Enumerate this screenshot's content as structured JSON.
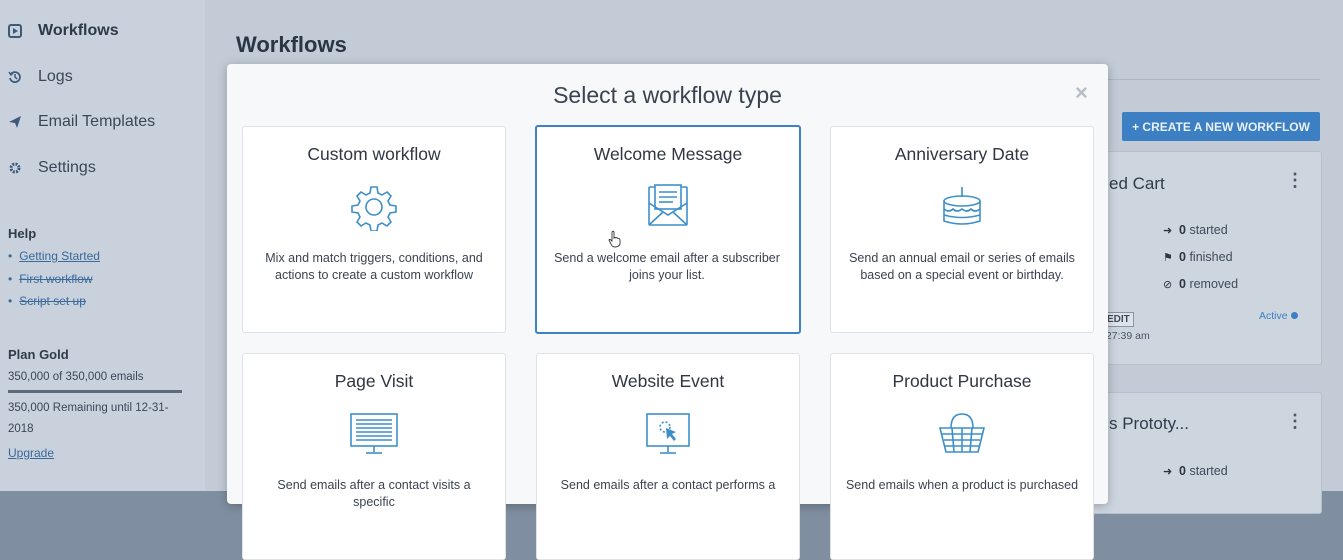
{
  "sidebar": {
    "nav": [
      {
        "label": "Workflows",
        "icon": "play-square-icon",
        "active": true
      },
      {
        "label": "Logs",
        "icon": "history-icon"
      },
      {
        "label": "Email Templates",
        "icon": "paper-plane-icon"
      },
      {
        "label": "Settings",
        "icon": "gear-icon"
      }
    ],
    "help_title": "Help",
    "help_links": [
      "Getting Started",
      "First workflow",
      "Script set up"
    ],
    "plan_title": "Plan Gold",
    "plan_usage": "350,000 of 350,000 emails",
    "plan_remaining_1": "350,000 Remaining until 12-31-",
    "plan_remaining_2": "2018",
    "upgrade": "Upgrade"
  },
  "main": {
    "title": "Workflows",
    "create_button": "+ CREATE A NEW WORKFLOW",
    "cards": [
      {
        "title": "ed Cart",
        "started": "0",
        "started_label": "started",
        "finished": "0",
        "finished_label": "finished",
        "removed": "0",
        "removed_label": "removed",
        "edit": "EDIT",
        "time": ":27:39 am",
        "status": "Active"
      },
      {
        "title": "s Prototy...",
        "started": "0",
        "started_label": "started"
      }
    ]
  },
  "modal": {
    "title": "Select a workflow type",
    "close": "×",
    "options": [
      {
        "title": "Custom workflow",
        "icon": "gear-icon",
        "desc": "Mix and match triggers, conditions, and actions to create a custom workflow"
      },
      {
        "title": "Welcome Message",
        "icon": "envelope-icon",
        "desc": "Send a welcome email after a subscriber joins your list.",
        "selected": true
      },
      {
        "title": "Anniversary Date",
        "icon": "birthday-cake-icon",
        "desc": "Send an annual email or series of emails based on a special event or birthday."
      },
      {
        "title": "Page Visit",
        "icon": "monitor-icon",
        "desc": "Send emails after a contact visits a specific"
      },
      {
        "title": "Website Event",
        "icon": "monitor-click-icon",
        "desc": "Send emails after a contact performs a"
      },
      {
        "title": "Product Purchase",
        "icon": "shopping-basket-icon",
        "desc": "Send emails when a product is purchased"
      }
    ]
  },
  "colors": {
    "accent": "#3c82c4",
    "icon_stroke": "#3d8fc9",
    "overlay": "#c2cbd6"
  }
}
